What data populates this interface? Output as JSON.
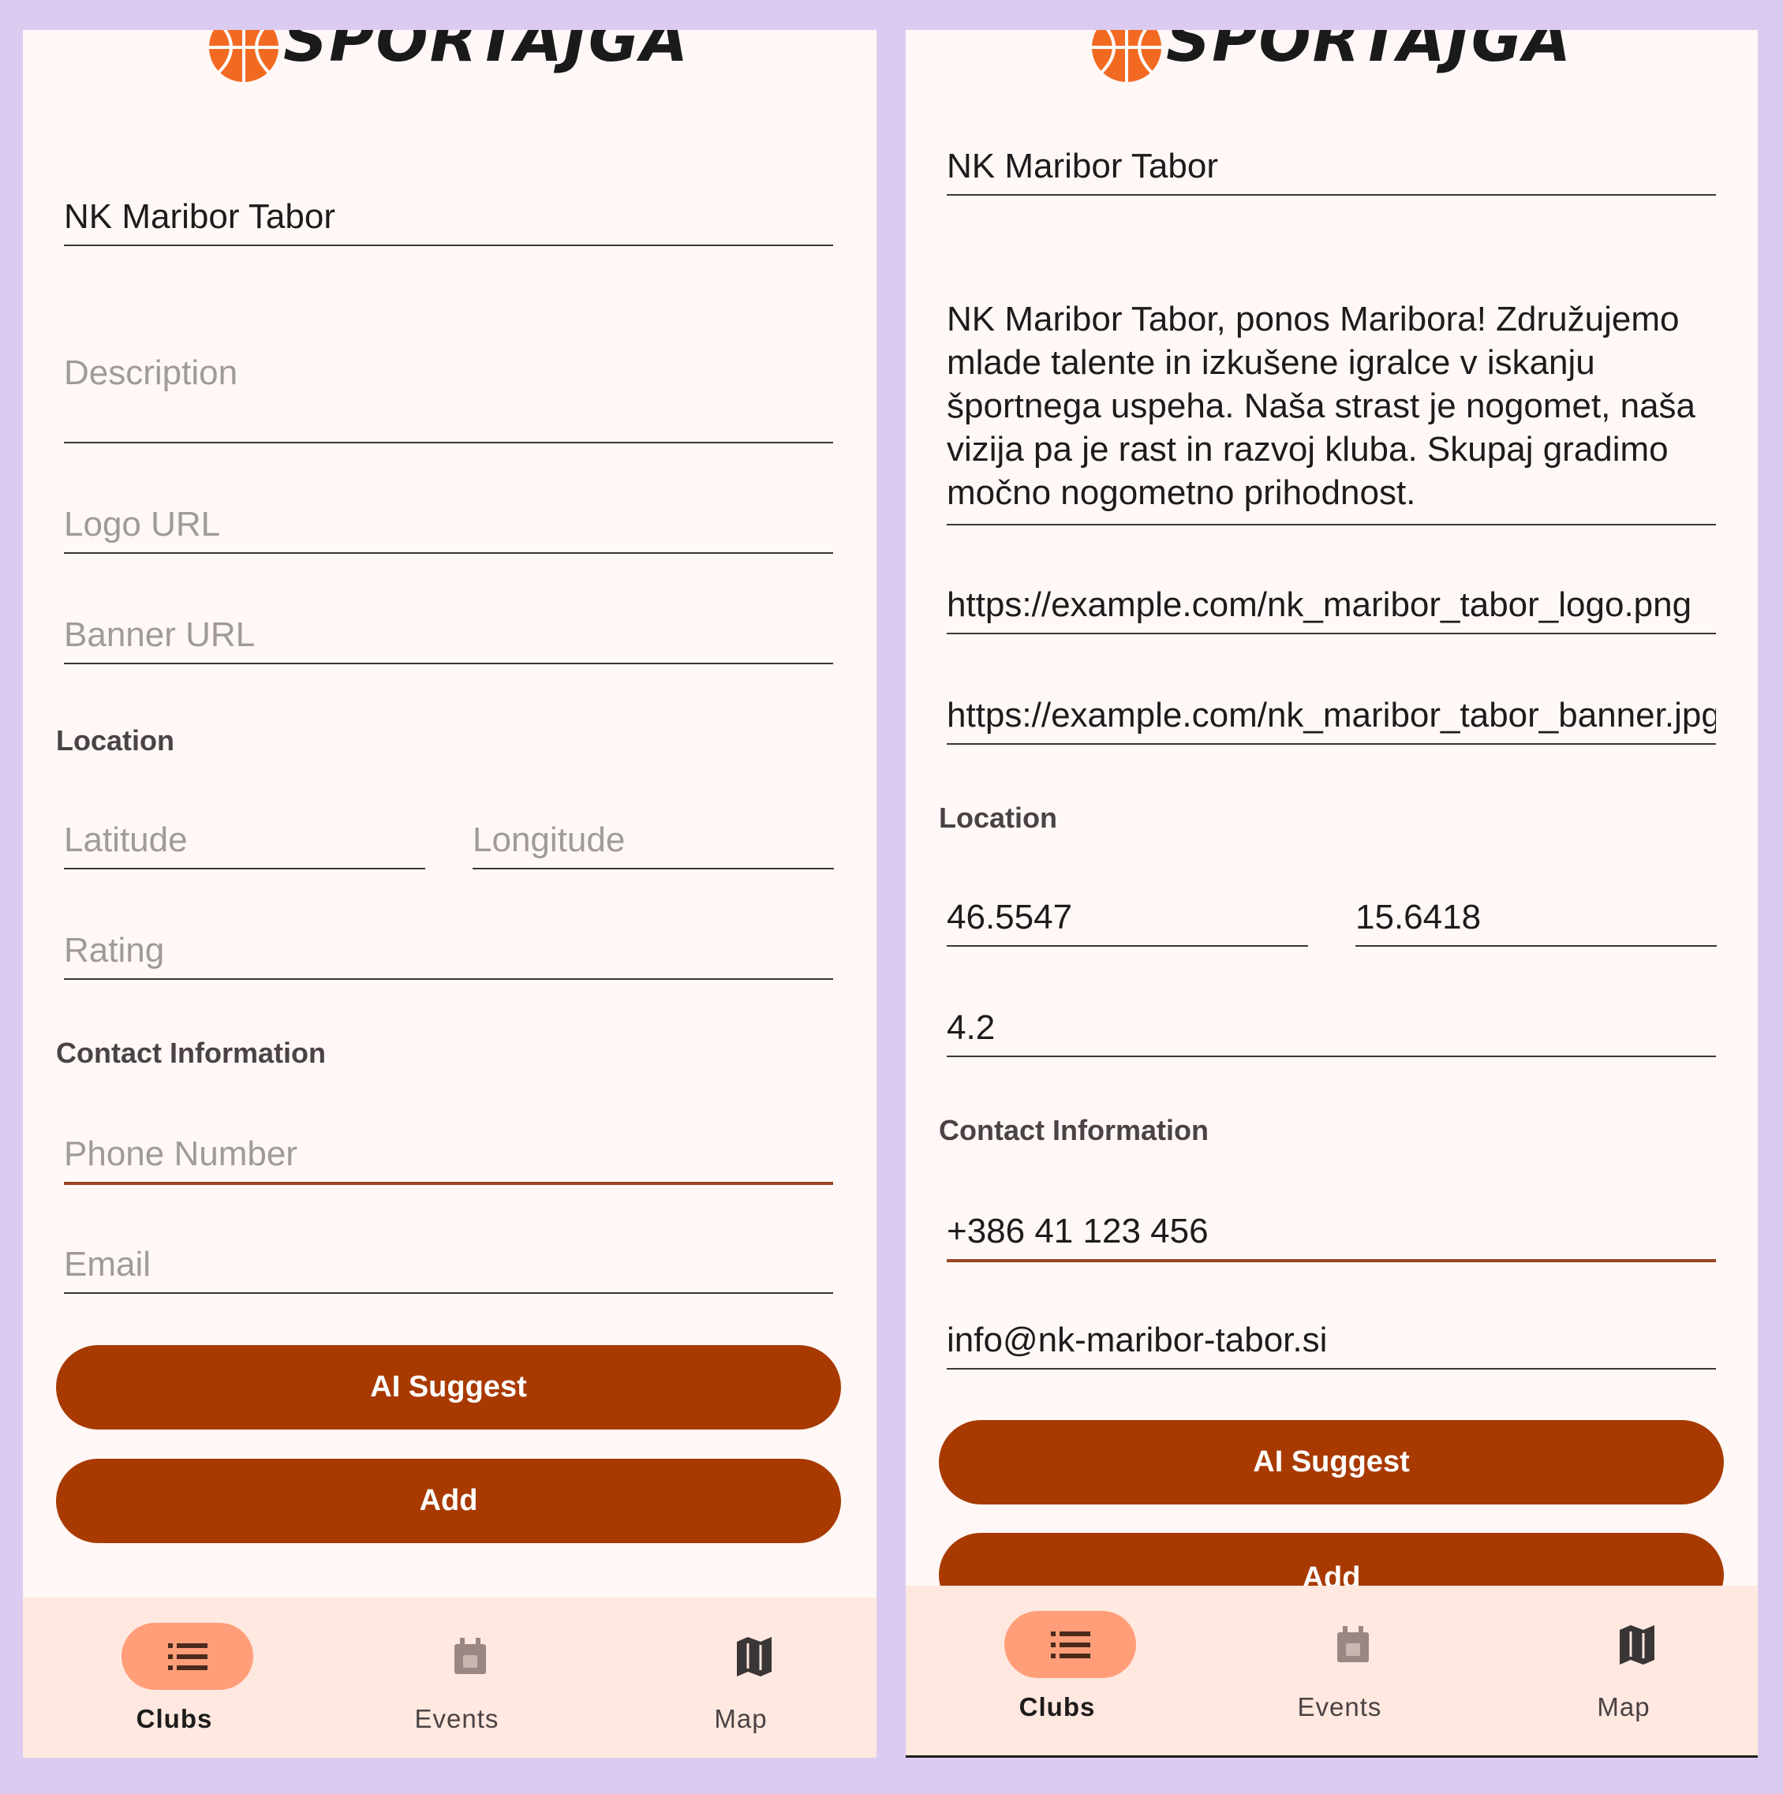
{
  "app": {
    "logo_text": "SPORTAJGA",
    "colors": {
      "primary": "#a83a00",
      "accent": "#ff9e78",
      "ball": "#f26a22"
    }
  },
  "left": {
    "name_value": "NK Maribor Tabor",
    "description_placeholder": "Description",
    "logo_placeholder": "Logo URL",
    "banner_placeholder": "Banner URL",
    "location_label": "Location",
    "latitude_placeholder": "Latitude",
    "longitude_placeholder": "Longitude",
    "rating_placeholder": "Rating",
    "contact_label": "Contact Information",
    "phone_placeholder": "Phone Number",
    "email_placeholder": "Email",
    "ai_button": "AI Suggest",
    "add_button": "Add"
  },
  "right": {
    "name_value": "NK Maribor Tabor",
    "description_value": "NK Maribor Tabor, ponos Maribora! Združujemo mlade talente in izkušene igralce v iskanju športnega uspeha.  Naša strast je nogomet, naša vizija pa je rast in razvoj kluba. Skupaj gradimo močno nogometno prihodnost.",
    "logo_value": "https://example.com/nk_maribor_tabor_logo.png",
    "banner_value": "https://example.com/nk_maribor_tabor_banner.jpg",
    "location_label": "Location",
    "latitude_value": "46.5547",
    "longitude_value": "15.6418",
    "rating_value": "4.2",
    "contact_label": "Contact Information",
    "phone_value": "+386 41 123 456",
    "email_value": "info@nk-maribor-tabor.si",
    "ai_button": "AI Suggest",
    "add_button": "Add"
  },
  "nav": {
    "clubs": {
      "label": "Clubs",
      "icon": "list-icon"
    },
    "events": {
      "label": "Events",
      "icon": "calendar-icon"
    },
    "map": {
      "label": "Map",
      "icon": "map-icon"
    }
  }
}
